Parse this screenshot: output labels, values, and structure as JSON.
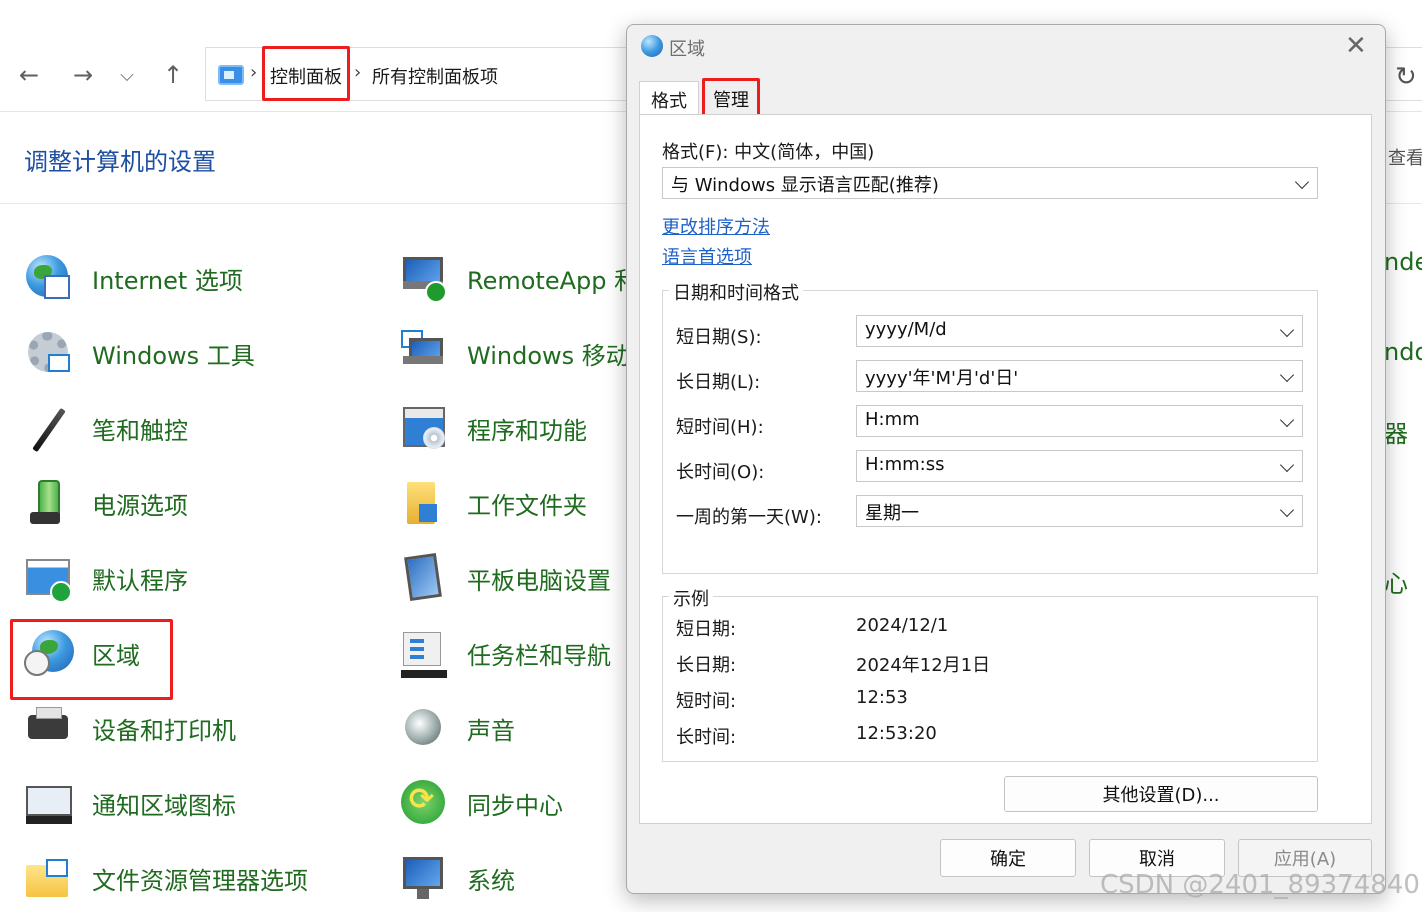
{
  "nav": {
    "back_icon": "arrow-left-icon",
    "forward_icon": "arrow-right-icon",
    "recent_icon": "chevron-down-icon",
    "up_icon": "arrow-up-icon",
    "breadcrumb": [
      "控制面板",
      "所有控制面板项"
    ],
    "refresh_icon": "refresh-icon"
  },
  "page": {
    "title": "调整计算机的设置",
    "view_by": "查看"
  },
  "items_left": [
    {
      "label": "Internet 选项",
      "icon": "internet-options-icon"
    },
    {
      "label": "Windows 工具",
      "icon": "windows-tools-icon"
    },
    {
      "label": "笔和触控",
      "icon": "pen-touch-icon"
    },
    {
      "label": "电源选项",
      "icon": "power-options-icon"
    },
    {
      "label": "默认程序",
      "icon": "default-programs-icon"
    },
    {
      "label": "区域",
      "icon": "region-icon"
    },
    {
      "label": "设备和打印机",
      "icon": "devices-printers-icon"
    },
    {
      "label": "通知区域图标",
      "icon": "notification-area-icon"
    },
    {
      "label": "文件资源管理器选项",
      "icon": "file-explorer-options-icon"
    }
  ],
  "items_mid": [
    {
      "label": "RemoteApp 和",
      "icon": "remoteapp-icon"
    },
    {
      "label": "Windows 移动",
      "icon": "windows-mobility-icon"
    },
    {
      "label": "程序和功能",
      "icon": "programs-features-icon"
    },
    {
      "label": "工作文件夹",
      "icon": "work-folders-icon"
    },
    {
      "label": "平板电脑设置",
      "icon": "tablet-settings-icon"
    },
    {
      "label": "任务栏和导航",
      "icon": "taskbar-navigation-icon"
    },
    {
      "label": "声音",
      "icon": "sound-icon"
    },
    {
      "label": "同步中心",
      "icon": "sync-center-icon"
    },
    {
      "label": "系统",
      "icon": "system-icon"
    }
  ],
  "items_right_fragments": [
    "nde",
    "ndo",
    "器",
    "心"
  ],
  "dialog": {
    "title": "区域",
    "close_icon": "close-icon",
    "tabs": [
      "格式",
      "管理"
    ],
    "format_label": "格式(F): 中文(简体，中国)",
    "format_value": "与 Windows 显示语言匹配(推荐)",
    "links": [
      "更改排序方法",
      "语言首选项"
    ],
    "datetime_group": "日期和时间格式",
    "fields": [
      {
        "label": "短日期(S):",
        "value": "yyyy/M/d"
      },
      {
        "label": "长日期(L):",
        "value": "yyyy'年'M'月'd'日'"
      },
      {
        "label": "短时间(H):",
        "value": "H:mm"
      },
      {
        "label": "长时间(O):",
        "value": "H:mm:ss"
      },
      {
        "label": "一周的第一天(W):",
        "value": "星期一"
      }
    ],
    "example_group": "示例",
    "examples": [
      {
        "label": "短日期:",
        "value": "2024/12/1"
      },
      {
        "label": "长日期:",
        "value": "2024年12月1日"
      },
      {
        "label": "短时间:",
        "value": "12:53"
      },
      {
        "label": "长时间:",
        "value": "12:53:20"
      }
    ],
    "other_settings": "其他设置(D)...",
    "ok": "确定",
    "cancel": "取消",
    "apply": "应用(A)"
  },
  "watermark": "CSDN @2401_89374840"
}
